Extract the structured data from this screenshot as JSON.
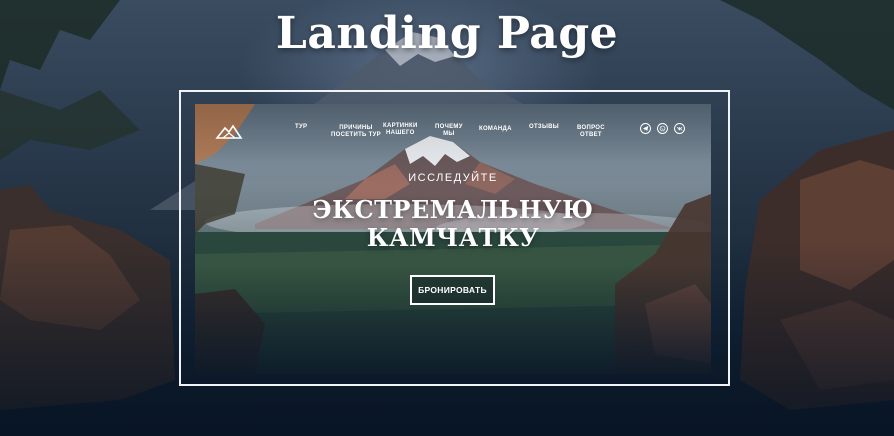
{
  "page_title": "Landing Page",
  "site": {
    "nav": {
      "items": [
        {
          "label": "ТУР"
        },
        {
          "label": "ПРИЧИНЫ\nПОСЕТИТЬ ТУР"
        },
        {
          "label": "КАРТИНКИ\nНАШЕГО"
        },
        {
          "label": "ПОЧЕМУ\nМЫ"
        },
        {
          "label": "КОМАНДА"
        },
        {
          "label": "ОТЗЫВЫ"
        },
        {
          "label": "ВОПРОС\nОТВЕТ"
        }
      ],
      "social": [
        "telegram-icon",
        "whatsapp-icon",
        "vk-icon"
      ]
    },
    "hero": {
      "kicker": "ИССЛЕДУЙТЕ",
      "title_line1": "ЭКСТРЕМАЛЬНУЮ",
      "title_line2": "КАМЧАТКУ",
      "cta_label": "БРОНИРОВАТЬ"
    }
  },
  "colors": {
    "frame": "#f1f3f6",
    "text": "#ffffff",
    "background_dark": "#0b1726"
  }
}
